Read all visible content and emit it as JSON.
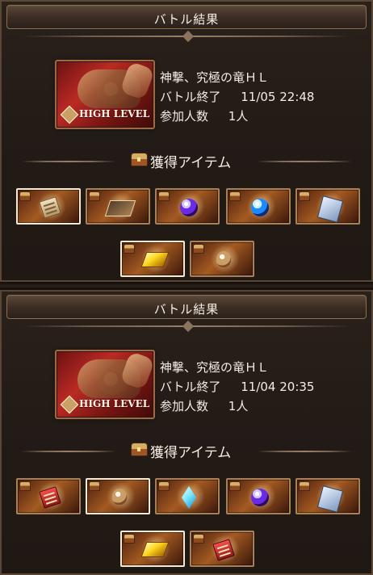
{
  "results": [
    {
      "title": "バトル結果",
      "quest": {
        "name": "神撃、究極の竜ＨＬ",
        "battle_end_label": "バトル終了",
        "battle_end_value": "11/05 22:48",
        "participants_label": "参加人数",
        "participants_value": "1人",
        "difficulty_label": "HIGH LEVEL"
      },
      "loot_title": "獲得アイテム",
      "items": [
        {
          "name": "document-item",
          "icon": "document-icon"
        },
        {
          "name": "document-item",
          "icon": "document-icon"
        },
        {
          "name": "purple-orb-item",
          "icon": "purple-orb-icon"
        },
        {
          "name": "blue-orb-item",
          "icon": "blue-orb-icon"
        },
        {
          "name": "card-item",
          "icon": "card-icon"
        },
        {
          "name": "gold-bar-item",
          "icon": "gold-bar-icon"
        },
        {
          "name": "pouch-item",
          "icon": "pouch-icon"
        }
      ]
    },
    {
      "title": "バトル結果",
      "quest": {
        "name": "神撃、究極の竜ＨＬ",
        "battle_end_label": "バトル終了",
        "battle_end_value": "11/04 20:35",
        "participants_label": "参加人数",
        "participants_value": "1人",
        "difficulty_label": "HIGH LEVEL"
      },
      "loot_title": "獲得アイテム",
      "items": [
        {
          "name": "red-document-item",
          "icon": "red-document-icon"
        },
        {
          "name": "pouch-item",
          "icon": "pouch-icon"
        },
        {
          "name": "crystal-item",
          "icon": "crystal-icon"
        },
        {
          "name": "orb-item",
          "icon": "orb-icon"
        },
        {
          "name": "card-item",
          "icon": "card-icon"
        },
        {
          "name": "gold-bar-item",
          "icon": "gold-bar-icon"
        },
        {
          "name": "red-document-item",
          "icon": "red-document-icon"
        }
      ]
    }
  ],
  "theme": {
    "background": "#1b1410",
    "panel": "#231b16",
    "accent": "#a98159",
    "banner_red": "#bb2a24",
    "text": "#f2e9dc"
  }
}
